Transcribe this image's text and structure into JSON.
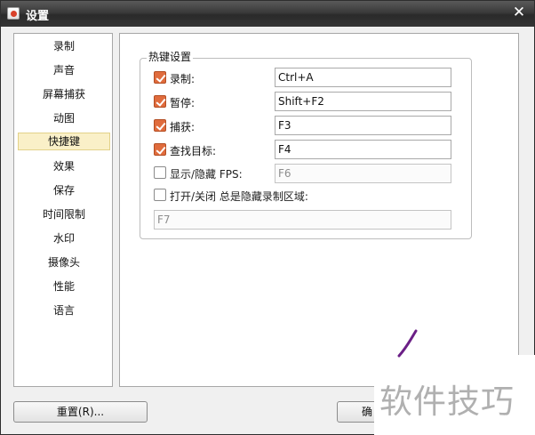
{
  "window": {
    "title": "设置",
    "close_glyph": "✕"
  },
  "sidebar": {
    "items": [
      {
        "label": "录制"
      },
      {
        "label": "声音"
      },
      {
        "label": "屏幕捕获"
      },
      {
        "label": "动图"
      },
      {
        "label": "快捷键",
        "selected": true
      },
      {
        "label": "效果"
      },
      {
        "label": "保存"
      },
      {
        "label": "时间限制"
      },
      {
        "label": "水印"
      },
      {
        "label": "摄像头"
      },
      {
        "label": "性能"
      },
      {
        "label": "语言"
      }
    ]
  },
  "hotkeys": {
    "group_title": "热键设置",
    "rows": [
      {
        "label": "录制:",
        "checked": true,
        "value": "Ctrl+A"
      },
      {
        "label": "暂停:",
        "checked": true,
        "value": "Shift+F2"
      },
      {
        "label": "捕获:",
        "checked": true,
        "value": "F3"
      },
      {
        "label": "查找目标:",
        "checked": true,
        "value": "F4"
      },
      {
        "label": "显示/隐藏 FPS:",
        "checked": false,
        "value": "F6"
      },
      {
        "label": "打开/关闭 总是隐藏录制区域:",
        "checked": false,
        "value": "F7"
      }
    ]
  },
  "buttons": {
    "reset_label": "重置(R)...",
    "ok_label": "确"
  },
  "watermark": {
    "text": "软件技巧"
  },
  "colors": {
    "checkbox_checked": "#e06c3d",
    "selected_item_bg": "#faf0c8",
    "titlebar": "#2f2f2f",
    "watermark_stroke": "#6b1f86"
  }
}
